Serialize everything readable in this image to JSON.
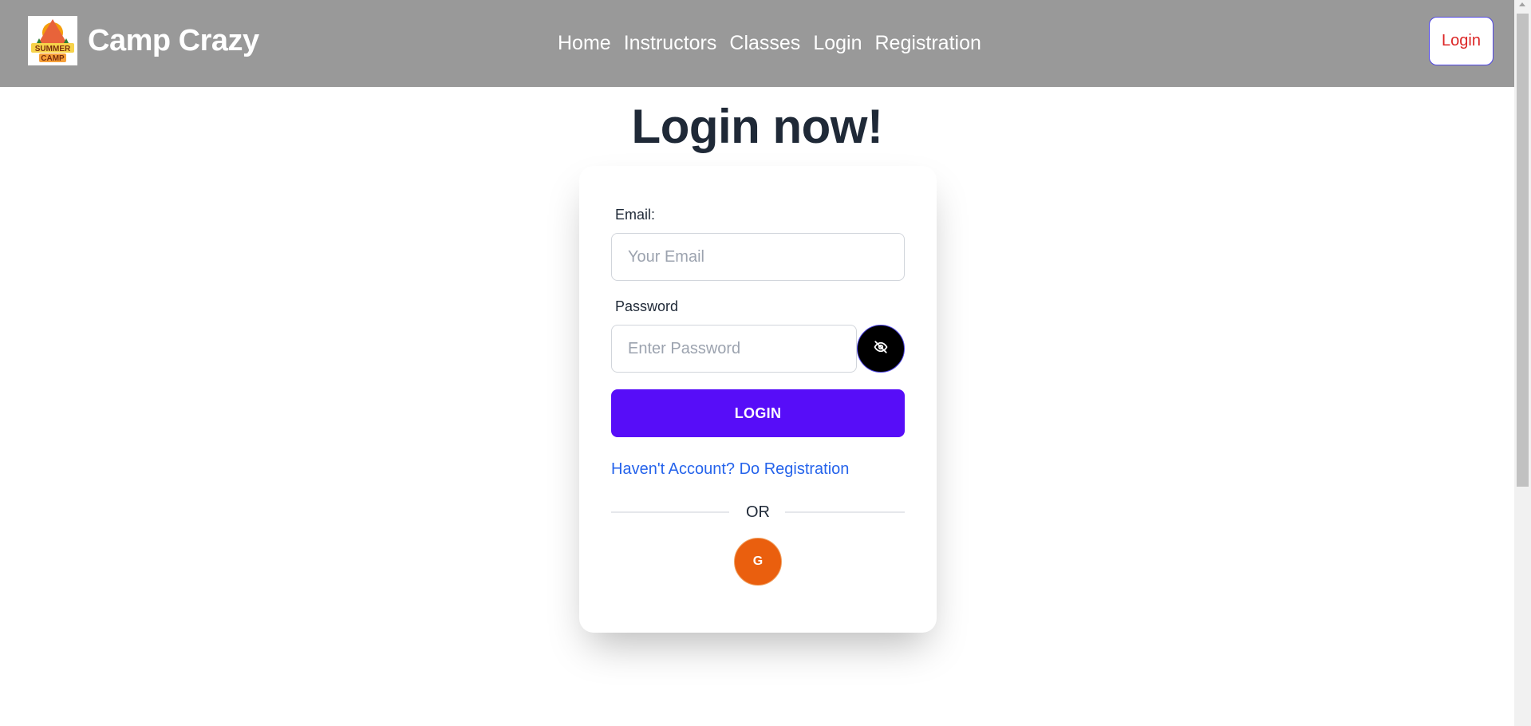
{
  "navbar": {
    "brand": "Camp Crazy",
    "logo": {
      "line1": "SUMMER",
      "line2": "CAMP",
      "icon": "summer-camp-logo"
    },
    "links": [
      "Home",
      "Instructors",
      "Classes",
      "Login",
      "Registration"
    ],
    "login_button": "Login"
  },
  "main": {
    "title": "Login now!",
    "form": {
      "email_label": "Email:",
      "email_placeholder": "Your Email",
      "email_value": "",
      "password_label": "Password",
      "password_placeholder": "Enter Password",
      "password_value": "",
      "toggle_icon": "eye-slash-icon",
      "login_button": "LOGIN",
      "register_link": "Haven't Account? Do Registration",
      "divider_text": "OR",
      "google_button": "G"
    }
  },
  "colors": {
    "navbar_bg": "#999999",
    "primary": "#570df8",
    "link": "#2563eb",
    "google": "#ea5f0e",
    "nav_login_text": "#dc2626"
  }
}
